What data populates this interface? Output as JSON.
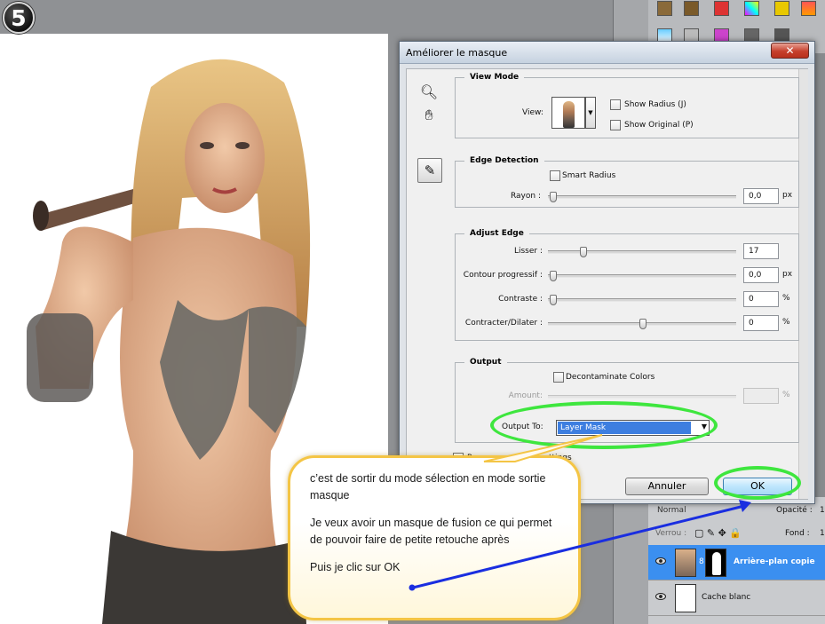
{
  "step_number": "5",
  "dialog": {
    "title": "Améliorer le masque",
    "close_label": "✕",
    "view_mode": {
      "legend": "View Mode",
      "view_label": "View:",
      "show_radius": "Show Radius (J)",
      "show_original": "Show Original (P)"
    },
    "edge_detection": {
      "legend": "Edge Detection",
      "smart_radius": "Smart Radius",
      "rayon_label": "Rayon :",
      "rayon_value": "0,0",
      "rayon_unit": "px",
      "rayon_level": 0
    },
    "adjust_edge": {
      "legend": "Adjust Edge",
      "rows": [
        {
          "label": "Lisser :",
          "value": "17",
          "unit": "",
          "level": 0.17
        },
        {
          "label": "Contour progressif :",
          "value": "0,0",
          "unit": "px",
          "level": 0
        },
        {
          "label": "Contraste :",
          "value": "0",
          "unit": "%",
          "level": 0
        },
        {
          "label": "Contracter/Dilater :",
          "value": "0",
          "unit": "%",
          "level": 0.5
        }
      ]
    },
    "output": {
      "legend": "Output",
      "decontaminate": "Decontaminate Colors",
      "amount_label": "Amount:",
      "amount_unit": "%",
      "output_to_label": "Output To:",
      "output_to_value": "Layer Mask"
    },
    "remember_label": "Re",
    "remember_tail": "ttings",
    "cancel_label": "Annuler",
    "ok_label": "OK"
  },
  "layers_panel": {
    "blend_mode": "Normal",
    "opacity_label": "Opacité :",
    "opacity_value": "1",
    "lock_label": "Verrou :",
    "fill_label": "Fond :",
    "fill_value": "1",
    "layers": [
      {
        "name": "Arrière-plan copie",
        "selected": true
      },
      {
        "name": "Cache blanc",
        "selected": false
      }
    ]
  },
  "callout": {
    "p1": "c’est de sortir du mode sélection en mode sortie masque",
    "p2": "Je veux avoir un masque de fusion ce qui permet de pouvoir faire de petite retouche après",
    "p3": "Puis je clic sur OK"
  },
  "colors": {
    "highlight_ring": "#3ee63e",
    "arrow": "#1a2ee0",
    "callout_border": "#f4c545",
    "selection": "#3d7ee0"
  }
}
